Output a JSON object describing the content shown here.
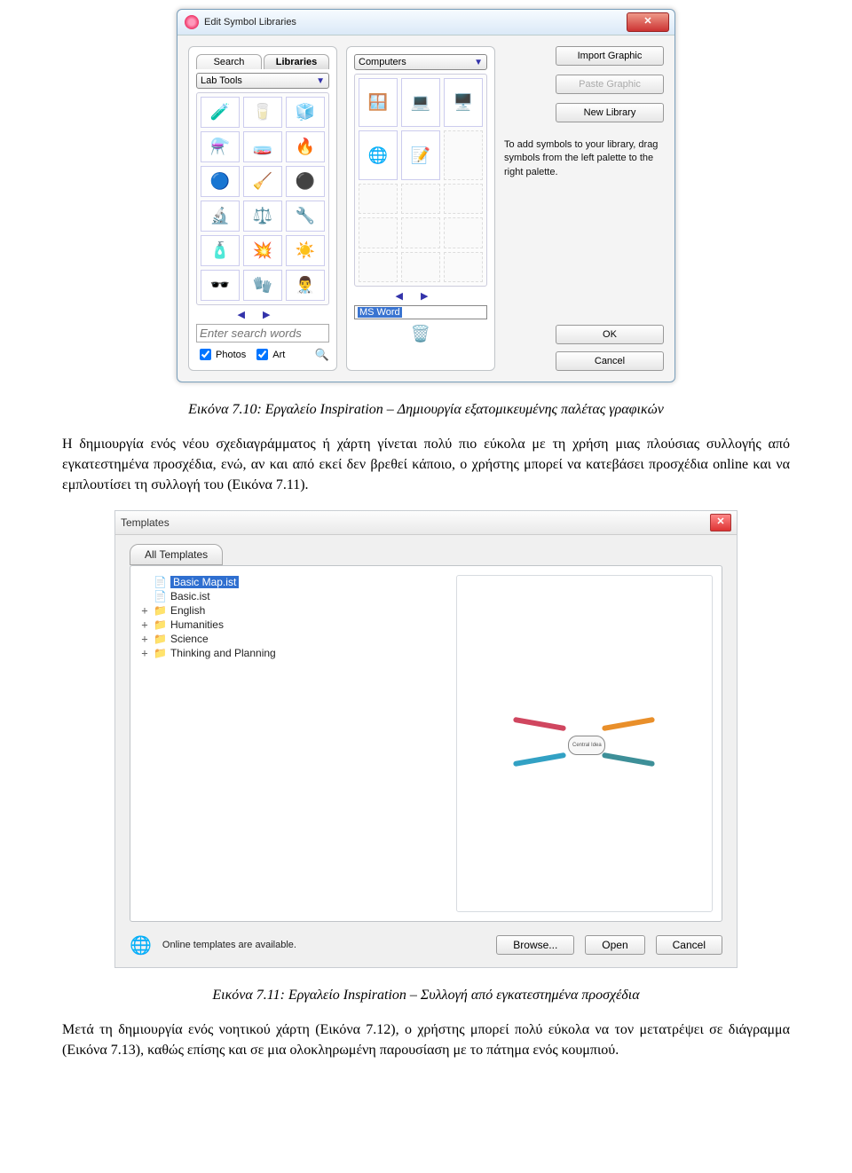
{
  "fig710": {
    "window_title": "Edit Symbol Libraries",
    "tabs": {
      "search": "Search",
      "libraries": "Libraries"
    },
    "left_combo": "Lab Tools",
    "search_placeholder": "Enter search words",
    "check_photos": "Photos",
    "check_art": "Art",
    "mid_combo": "Computers",
    "named_value": "MS Word",
    "btn_import": "Import Graphic",
    "btn_paste": "Paste Graphic",
    "btn_newlib": "New Library",
    "help_text": "To add symbols to your library, drag symbols from the left palette to the right palette.",
    "btn_ok": "OK",
    "btn_cancel": "Cancel",
    "thumbs_left": [
      "🧪",
      "🥛",
      "🧊",
      "⚗️",
      "🧫",
      "🔥",
      "🔵",
      "🧹",
      "⚫",
      "🔬",
      "⚖️",
      "🔧",
      "🧴",
      "💥",
      "☀️",
      "🕶️",
      "🧤",
      "👨‍⚕️"
    ],
    "thumbs_mid": [
      "🪟",
      "💻",
      "🖥️",
      "🌐",
      "📝"
    ]
  },
  "caption710": "Εικόνα 7.10: Εργαλείο Inspiration – Δημιουργία εξατομικευμένης παλέτας γραφικών",
  "para1": "Η δημιουργία ενός νέου σχεδιαγράμματος ή χάρτη γίνεται πολύ πιο εύκολα με τη χρήση μιας πλούσιας συλλογής από εγκατεστημένα προσχέδια, ενώ, αν και από εκεί δεν βρεθεί κάποιο, ο χρήστης μπορεί να κατεβάσει προσχέδια online  και να εμπλουτίσει τη συλλογή του (Εικόνα 7.11).",
  "fig711": {
    "window_title": "Templates",
    "tab_all": "All Templates",
    "tree": [
      {
        "expand": "",
        "icon": "📄",
        "label": "Basic Map.ist",
        "selected": true
      },
      {
        "expand": "",
        "icon": "📄",
        "label": "Basic.ist"
      },
      {
        "expand": "+",
        "icon": "📁",
        "label": "English"
      },
      {
        "expand": "+",
        "icon": "📁",
        "label": "Humanities"
      },
      {
        "expand": "+",
        "icon": "📁",
        "label": "Science"
      },
      {
        "expand": "+",
        "icon": "📁",
        "label": "Thinking and Planning"
      }
    ],
    "preview_center": "Central Idea",
    "online_text": "Online templates are available.",
    "btn_browse": "Browse...",
    "btn_open": "Open",
    "btn_cancel": "Cancel"
  },
  "caption711": "Εικόνα 7.11: Εργαλείο Inspiration – Συλλογή από εγκατεστημένα προσχέδια",
  "para2": "Μετά τη δημιουργία ενός νοητικού χάρτη (Εικόνα 7.12), ο χρήστης μπορεί πολύ εύκολα να τον μετατρέψει σε διάγραμμα (Εικόνα 7.13), καθώς επίσης και σε μια ολοκληρωμένη παρουσίαση με το πάτημα ενός κουμπιού."
}
